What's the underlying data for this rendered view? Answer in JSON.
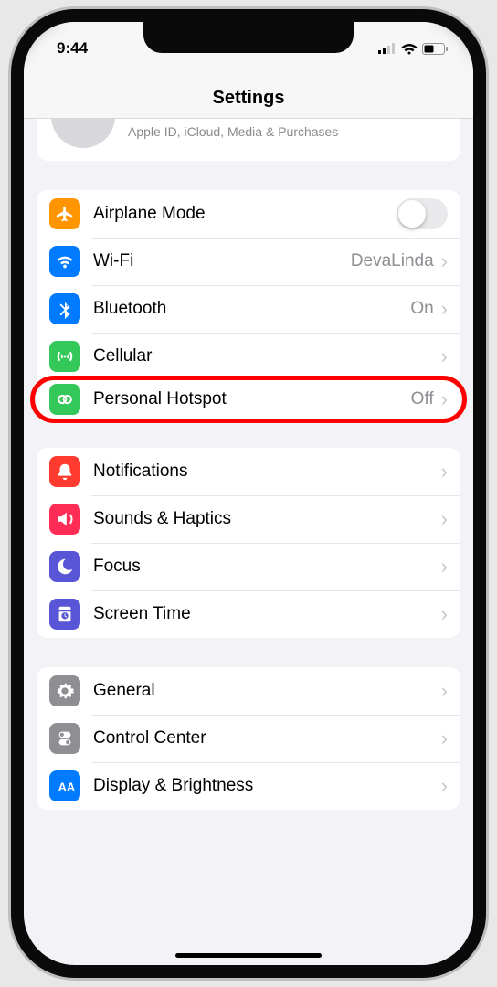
{
  "statusBar": {
    "time": "9:44"
  },
  "header": {
    "title": "Settings"
  },
  "appleId": {
    "subtitle": "Apple ID, iCloud, Media & Purchases"
  },
  "group1": {
    "airplane": {
      "label": "Airplane Mode"
    },
    "wifi": {
      "label": "Wi-Fi",
      "value": "DevaLinda"
    },
    "bluetooth": {
      "label": "Bluetooth",
      "value": "On"
    },
    "cellular": {
      "label": "Cellular"
    },
    "hotspot": {
      "label": "Personal Hotspot",
      "value": "Off"
    }
  },
  "group2": {
    "notifications": {
      "label": "Notifications"
    },
    "sounds": {
      "label": "Sounds & Haptics"
    },
    "focus": {
      "label": "Focus"
    },
    "screentime": {
      "label": "Screen Time"
    }
  },
  "group3": {
    "general": {
      "label": "General"
    },
    "controlcenter": {
      "label": "Control Center"
    },
    "display": {
      "label": "Display & Brightness"
    }
  }
}
